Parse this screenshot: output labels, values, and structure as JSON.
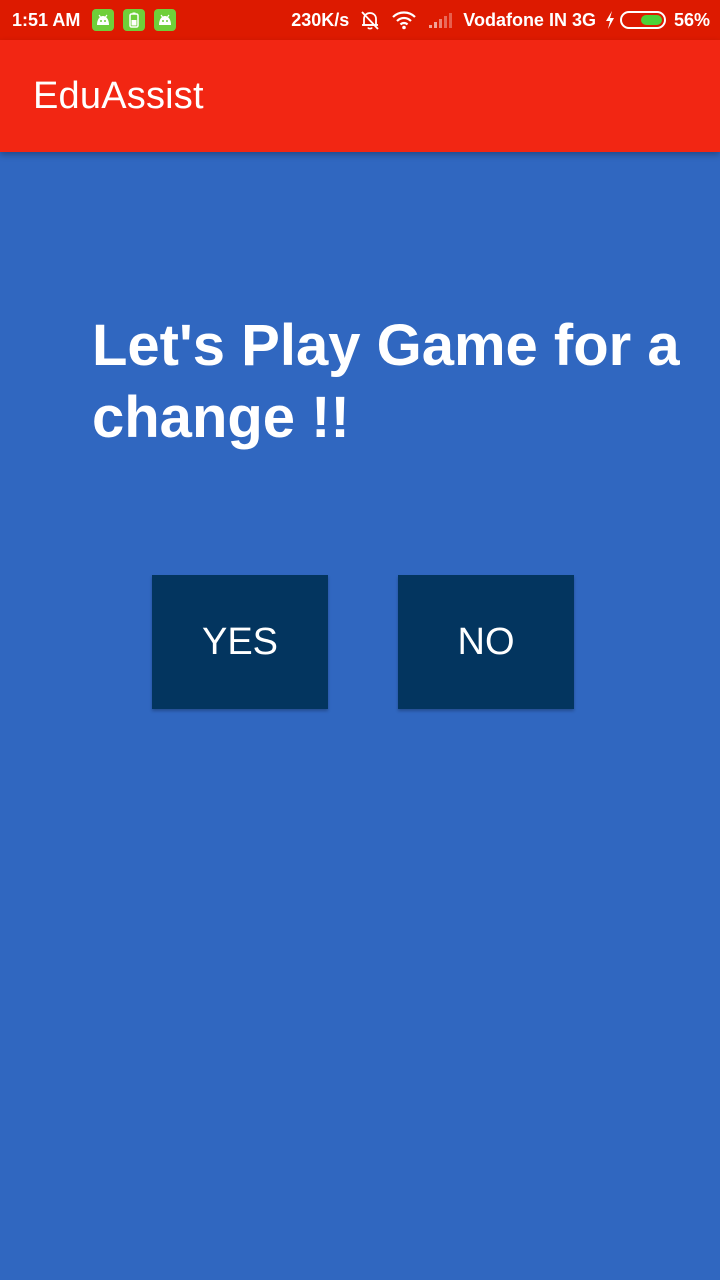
{
  "status_bar": {
    "time": "1:51 AM",
    "notification_icons": [
      "android-icon",
      "battery-app-icon",
      "android-icon"
    ],
    "net_speed": "230K/s",
    "carrier": "Vodafone IN 3G",
    "battery_percent": "56%",
    "battery_level": 0.56,
    "icons": [
      "bell-off-icon",
      "wifi-icon",
      "signal-icon",
      "charging-bolt-icon",
      "battery-icon"
    ]
  },
  "app_bar": {
    "title": "EduAssist"
  },
  "main": {
    "prompt": "Let's Play Game for a change !!",
    "yes_label": "YES",
    "no_label": "NO"
  },
  "colors": {
    "status_bar": "#dd1a00",
    "app_bar": "#f22613",
    "background": "#3067c0",
    "button": "#03355f",
    "text": "#ffffff"
  }
}
